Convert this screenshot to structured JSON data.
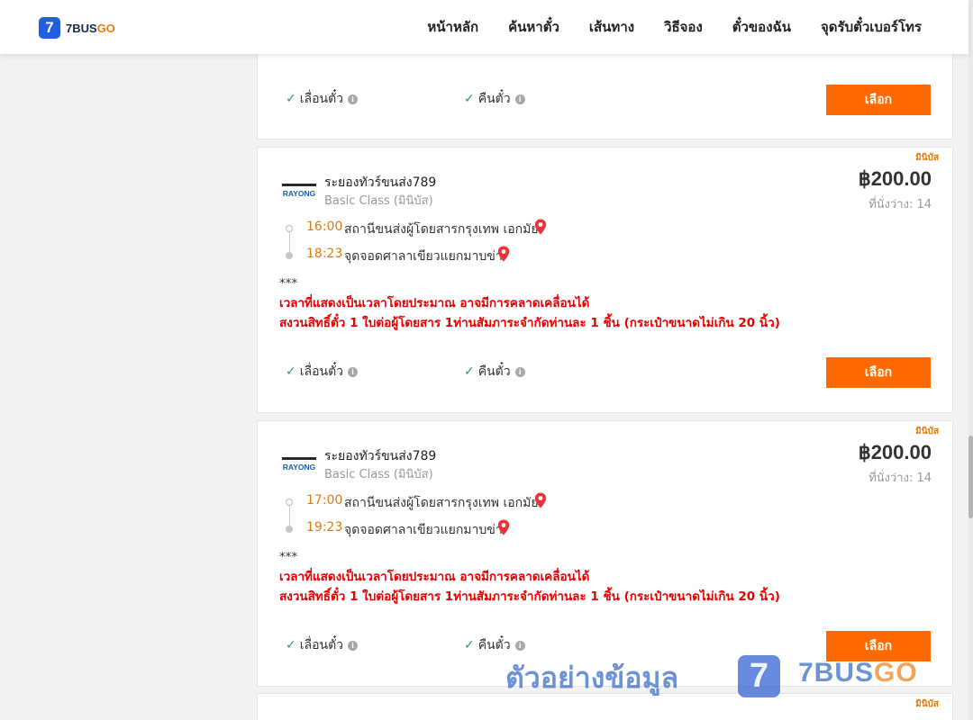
{
  "app": {
    "logo_badge": "7",
    "logo_text_main": "7BUS",
    "logo_text_accent": "GO",
    "brand_color": "#1f5fe0",
    "accent_color": "#ff6a00"
  },
  "nav": {
    "items": [
      "หน้าหลัก",
      "ค้นหาตั๋ว",
      "เส้นทาง",
      "วิธีจอง",
      "ตั๋วของฉัน",
      "จุดรับตั๋วเบอร์โทร"
    ]
  },
  "top_card": {
    "feature_change": "เลื่อนตั๋ว",
    "feature_refund": "คืนตั๋ว",
    "select_label": "เลือก"
  },
  "trips": [
    {
      "bus_type": "มินิบัส",
      "operator_logo_text": "RAYONG",
      "operator": "ระยองทัวร์ขนส่ง789",
      "class": "Basic Class (มินิบัส)",
      "price": "฿200.00",
      "seats": "ที่นั่งว่าง: 14",
      "depart_time": "16:00",
      "depart_stop": "สถานีขนส่งผู้โดยสารกรุงเทพ เอกมัย",
      "arrive_time": "18:23",
      "arrive_stop": "จุดจอดศาลาเขียวแยกมาบข่า",
      "note_stars": "***",
      "note_line1": "เวลาที่แสดงเป็นเวลาโดยประมาณ อาจมีการคลาดเคลื่อนได้",
      "note_line2": "สงวนสิทธิ์ตั๋ว 1 ใบต่อผู้โดยสาร 1ท่านสัมภาระจำกัดท่านละ 1 ชิ้น (กระเป๋าขนาดไม่เกิน 20 นิ้ว)",
      "feature_change": "เลื่อนตั๋ว",
      "feature_refund": "คืนตั๋ว",
      "select_label": "เลือก"
    },
    {
      "bus_type": "มินิบัส",
      "operator_logo_text": "RAYONG",
      "operator": "ระยองทัวร์ขนส่ง789",
      "class": "Basic Class (มินิบัส)",
      "price": "฿200.00",
      "seats": "ที่นั่งว่าง: 14",
      "depart_time": "17:00",
      "depart_stop": "สถานีขนส่งผู้โดยสารกรุงเทพ เอกมัย",
      "arrive_time": "19:23",
      "arrive_stop": "จุดจอดศาลาเขียวแยกมาบข่า",
      "note_stars": "***",
      "note_line1": "เวลาที่แสดงเป็นเวลาโดยประมาณ อาจมีการคลาดเคลื่อนได้",
      "note_line2": "สงวนสิทธิ์ตั๋ว 1 ใบต่อผู้โดยสาร 1ท่านสัมภาระจำกัดท่านละ 1 ชิ้น (กระเป๋าขนาดไม่เกิน 20 นิ้ว)",
      "feature_change": "เลื่อนตั๋ว",
      "feature_refund": "คืนตั๋ว",
      "select_label": "เลือก"
    },
    {
      "bus_type": "มินิบัส"
    }
  ],
  "watermark": {
    "text": "ตัวอย่างข้อมูล",
    "badge": "7",
    "brand_main": "7BUS",
    "brand_accent": "GO"
  }
}
